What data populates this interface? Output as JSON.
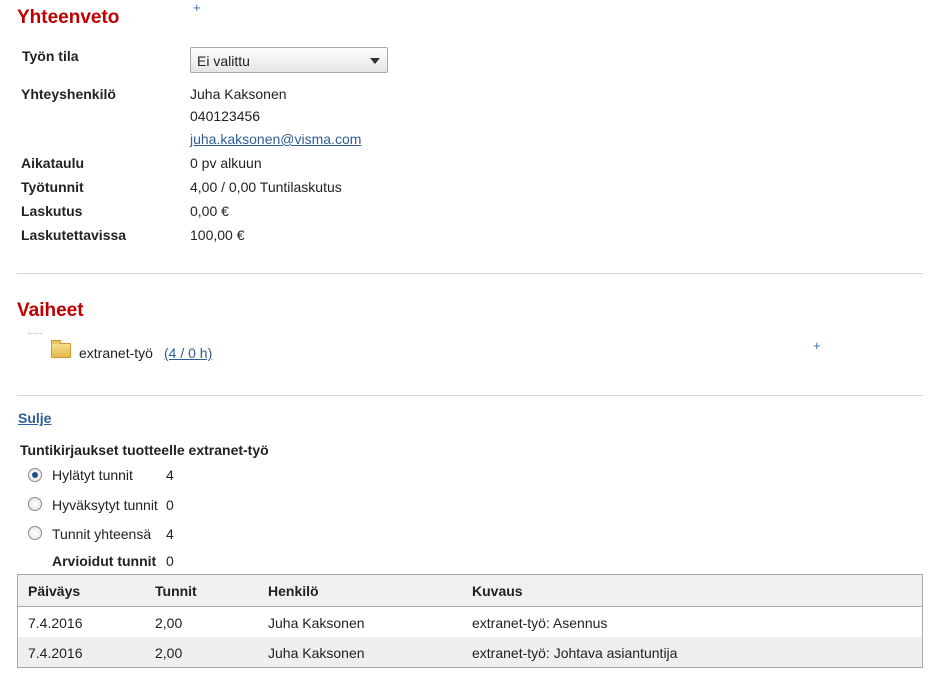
{
  "summary": {
    "title": "Yhteenveto",
    "add": "+",
    "status_label": "Työn tila",
    "status_value": "Ei valittu",
    "contact_label": "Yhteyshenkilö",
    "contact_name": "Juha Kaksonen",
    "contact_phone": "040123456",
    "contact_email": "juha.kaksonen@visma.com",
    "schedule_label": "Aikataulu",
    "schedule_value": "0 pv alkuun",
    "hours_label": "Työtunnit",
    "hours_value": "4,00 / 0,00 Tuntilaskutus",
    "billing_label": "Laskutus",
    "billing_value": "0,00 €",
    "billable_label": "Laskutettavissa",
    "billable_value": "100,00 €"
  },
  "phases": {
    "title": "Vaiheet",
    "tree_dots": "......",
    "item_name": "extranet-työ",
    "item_hours": "(4 / 0 h)",
    "add": "+"
  },
  "entries": {
    "close_link": "Sulje",
    "heading": "Tuntikirjaukset tuotteelle extranet-työ",
    "options": [
      {
        "label": "Hylätyt tunnit",
        "count": "4"
      },
      {
        "label": "Hyväksytyt tunnit",
        "count": "0"
      },
      {
        "label": "Tunnit yhteensä",
        "count": "4"
      }
    ],
    "estimated_label": "Arvioidut tunnit",
    "estimated_value": "0",
    "columns": [
      "Päiväys",
      "Tunnit",
      "Henkilö",
      "Kuvaus"
    ],
    "rows": [
      [
        "7.4.2016",
        "2,00",
        "Juha Kaksonen",
        "extranet-työ: Asennus"
      ],
      [
        "7.4.2016",
        "2,00",
        "Juha Kaksonen",
        "extranet-työ: Johtava asiantuntija"
      ]
    ]
  },
  "colors": {
    "heading_red": "#c00000",
    "link_blue": "#2f5e96",
    "radio_selected": "#1f4f8f"
  }
}
